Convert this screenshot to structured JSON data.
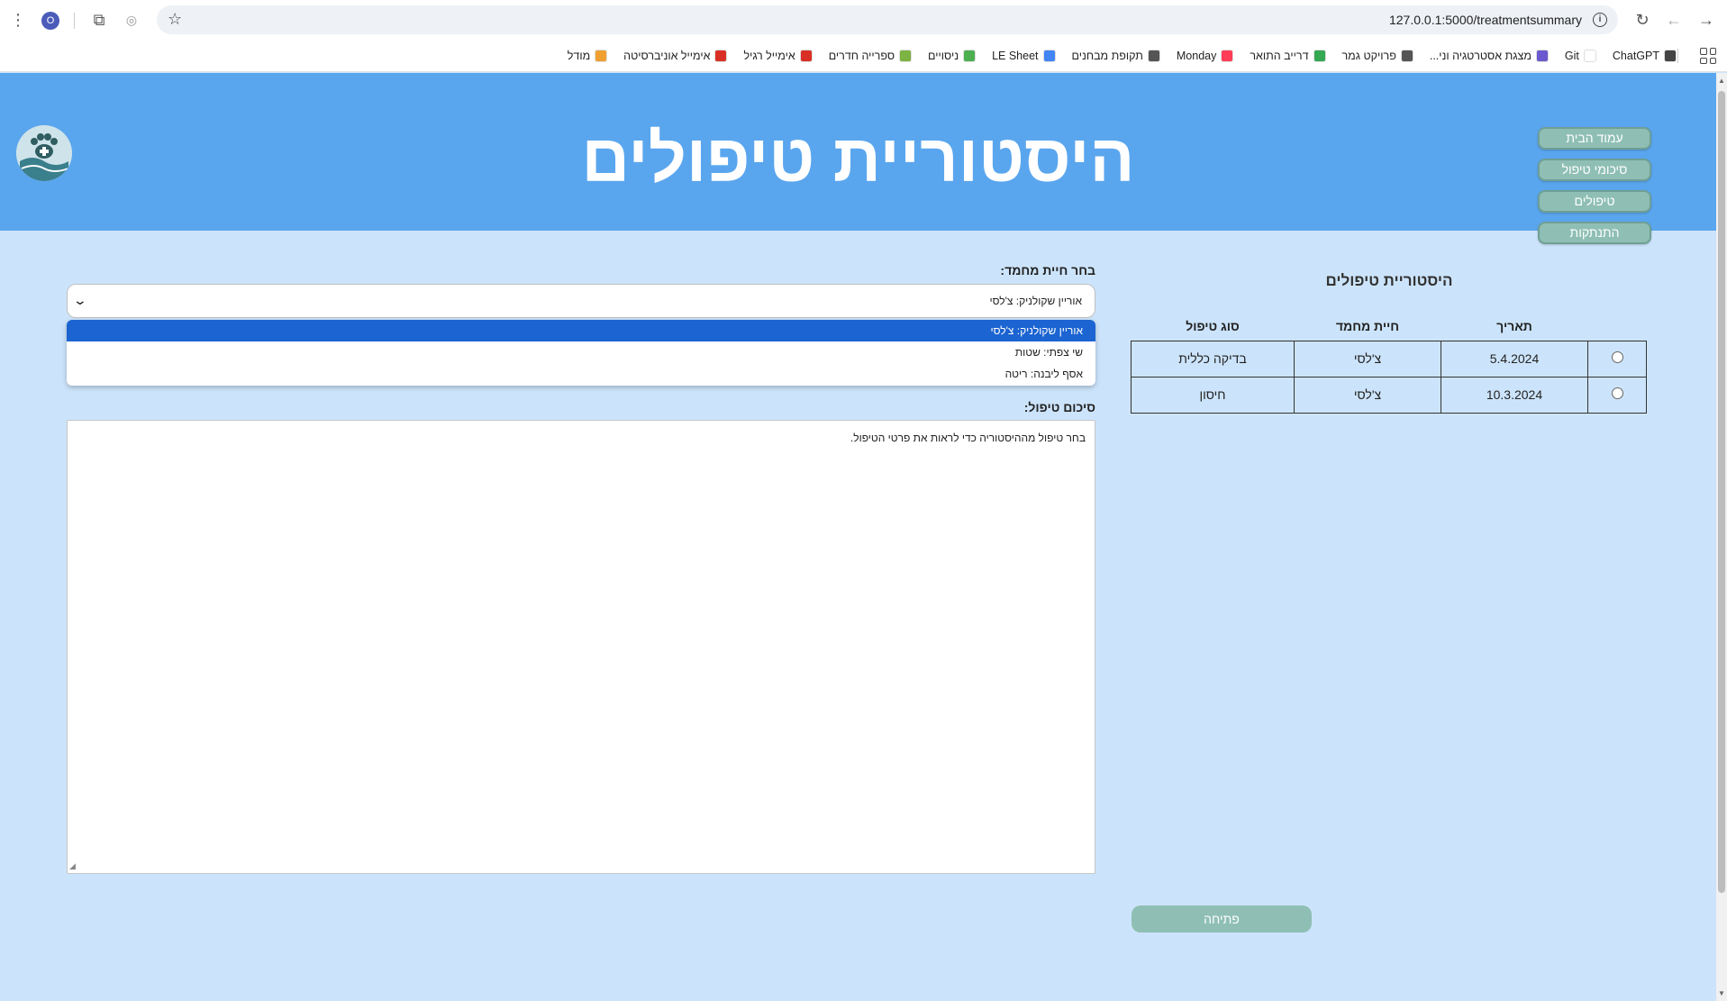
{
  "browser": {
    "profile_initial": "O",
    "url": "127.0.0.1:5000/treatmentsummary",
    "bookmarks": [
      {
        "label": "מודל",
        "color": "#f0a030"
      },
      {
        "label": "אימייל אוניברסיטה",
        "color": "#d93025"
      },
      {
        "label": "אימייל רגיל",
        "color": "#d93025"
      },
      {
        "label": "ספרייה חדרים",
        "color": "#7cb342"
      },
      {
        "label": "ניסויים",
        "color": "#4caf50"
      },
      {
        "label": "LE Sheet",
        "color": "#4285f4"
      },
      {
        "label": "תקופת מבחנים",
        "color": "#555555"
      },
      {
        "label": "Monday",
        "color": "#ff3d57"
      },
      {
        "label": "דרייב התואר",
        "color": "#34a853"
      },
      {
        "label": "פרויקט גמר",
        "color": "#555555"
      },
      {
        "label": "מצגת אסטרטגיה וני...",
        "color": "#6a5acd"
      },
      {
        "label": "Git",
        "color": "#ffffff"
      },
      {
        "label": "ChatGPT",
        "color": "#444444"
      }
    ]
  },
  "header": {
    "title": "היסטוריית טיפולים",
    "nav": [
      "עמוד הבית",
      "סיכומי טיפול",
      "טיפולים",
      "התנתקות"
    ]
  },
  "history": {
    "title": "היסטוריית טיפולים",
    "columns": {
      "date": "תאריך",
      "pet": "חיית מחמד",
      "type": "סוג טיפול"
    },
    "rows": [
      {
        "date": "5.4.2024",
        "pet": "צ'לסי",
        "type": "בדיקה כללית"
      },
      {
        "date": "10.3.2024",
        "pet": "צ'לסי",
        "type": "חיסון"
      }
    ],
    "open_button": "פתיחה"
  },
  "form": {
    "pet_label": "בחר חיית מחמד:",
    "pet_selected": "אוריין שקולניק: צ'לסי",
    "pet_options": [
      "אוריין שקולניק: צ'לסי",
      "שי צפתי: שטות",
      "אסף ליבנה: ריטה"
    ],
    "summary_label": "סיכום טיפול:",
    "summary_text": "בחר טיפול מההיסטוריה כדי לראות את פרטי הטיפול."
  },
  "colors": {
    "header_bg": "#5aa6ee",
    "page_bg": "#cce4fb",
    "button_bg": "#8fbfb4",
    "dropdown_selected": "#1b64d1"
  }
}
